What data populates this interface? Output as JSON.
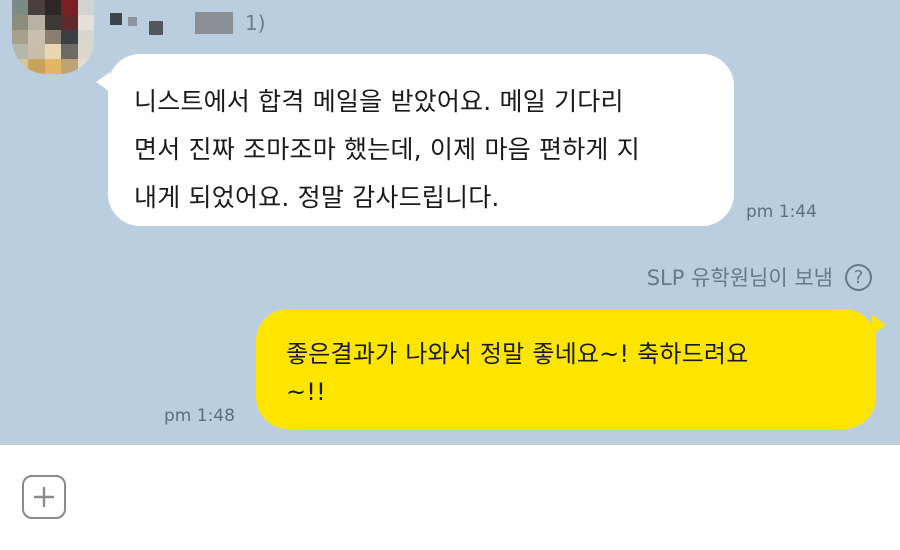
{
  "incoming": {
    "sender_suffix": "1)",
    "message": "니스트에서 합격 메일을 받았어요. 메일 기다리\n면서 진짜 조마조마 했는데, 이제 마음 편하게 지\n내게 되었어요. 정말 감사드립니다.",
    "time": "pm 1:44"
  },
  "system_note": {
    "text": "SLP 유학원님이 보냄",
    "help_glyph": "?"
  },
  "outgoing": {
    "message": "좋은결과가 나와서 정말 좋네요~! 축하드려요\n~!!",
    "time": "pm 1:48"
  },
  "input_bar": {
    "attach_icon": "plus-icon"
  },
  "colors": {
    "chat_background": "#bacee0",
    "incoming_bubble": "#ffffff",
    "outgoing_bubble": "#fee500"
  }
}
